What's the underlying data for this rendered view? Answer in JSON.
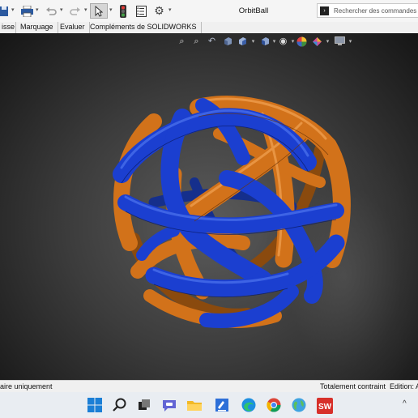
{
  "window": {
    "title": "OrbitBall",
    "search_placeholder": "Rechercher des commandes"
  },
  "tabs": [
    "isse",
    "Marquage",
    "Evaluer",
    "Compléments de SOLIDWORKS"
  ],
  "status": {
    "left": "aire uniquement",
    "constraint": "Totalement contraint",
    "edit": "Edition: A"
  },
  "icons": {
    "toolbar": [
      "save-icon",
      "print-icon",
      "undo-icon",
      "redo-icon",
      "select-cursor-icon",
      "traffic-light-icon",
      "file-properties-icon",
      "options-gear-icon"
    ],
    "view_hud": [
      "zoom-to-fit-icon",
      "zoom-to-area-icon",
      "previous-view-icon",
      "section-view-icon",
      "view-orientation-icon",
      "display-style-icon",
      "hide-show-icon",
      "appearance-icon",
      "scene-icon",
      "view-settings-icon"
    ],
    "taskbar": [
      "windows-start-icon",
      "search-icon",
      "task-view-icon",
      "teams-chat-icon",
      "file-explorer-icon",
      "sticky-notes-icon",
      "edge-browser-icon",
      "chrome-browser-icon",
      "globe-app-icon",
      "solidworks-icon"
    ]
  },
  "colors": {
    "orange_band": "#d2721a",
    "blue_band": "#1b3fd0",
    "viewport_center": "#5b5b5b",
    "viewport_edge": "#070707"
  }
}
